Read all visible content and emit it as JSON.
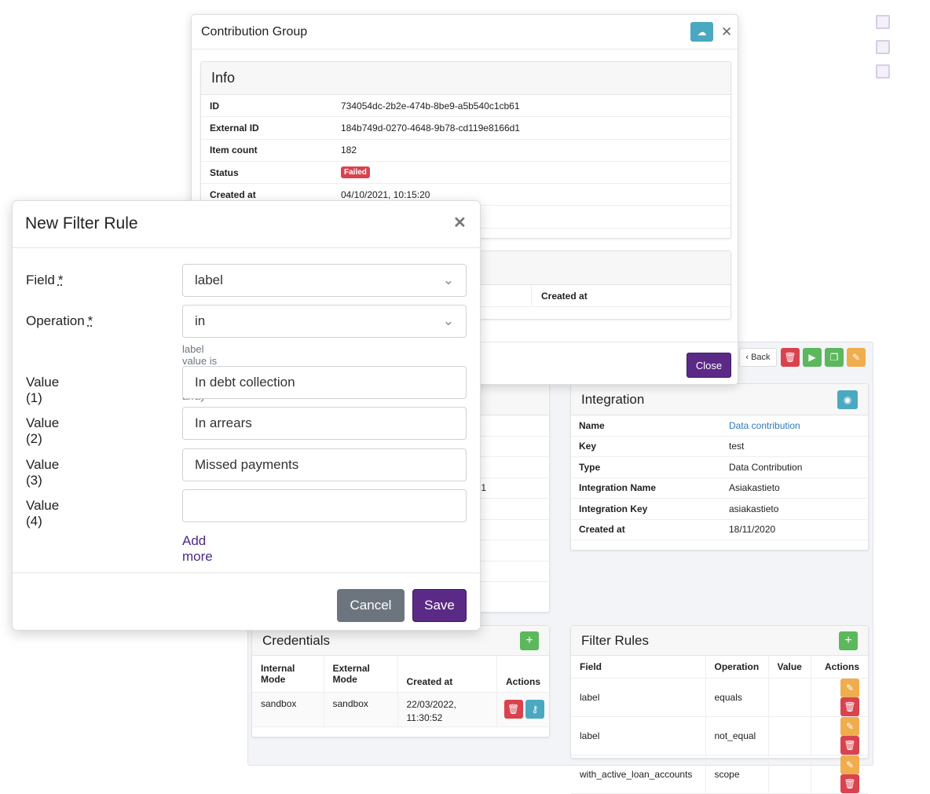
{
  "checkboxes": [
    false,
    false,
    false
  ],
  "toolbar": {
    "back_label": "Back",
    "buttons": [
      "trash-icon",
      "play-icon",
      "copy-icon",
      "edit-icon"
    ]
  },
  "left_card": {
    "visible_fragment": "1"
  },
  "integration": {
    "title": "Integration",
    "rows": [
      {
        "k": "Name",
        "v": "Data contribution",
        "link": true
      },
      {
        "k": "Key",
        "v": "test"
      },
      {
        "k": "Type",
        "v": "Data Contribution"
      },
      {
        "k": "Integration Name",
        "v": "Asiakastieto"
      },
      {
        "k": "Integration Key",
        "v": "asiakastieto"
      },
      {
        "k": "Created at",
        "v": "18/11/2020"
      }
    ]
  },
  "credentials": {
    "title": "Credentials",
    "headers": [
      "Internal Mode",
      "External Mode",
      "Created at",
      "Actions"
    ],
    "rows": [
      {
        "internal": "sandbox",
        "external": "sandbox",
        "created_at": "22/03/2022, 11:30:52"
      }
    ]
  },
  "filter_rules": {
    "title": "Filter Rules",
    "headers": [
      "Field",
      "Operation",
      "Value",
      "Actions"
    ],
    "rows": [
      {
        "field": "label",
        "operation": "equals",
        "value": ""
      },
      {
        "field": "label",
        "operation": "not_equal",
        "value": ""
      },
      {
        "field": "with_active_loan_accounts",
        "operation": "scope",
        "value": ""
      }
    ]
  },
  "contribution_modal": {
    "title": "Contribution Group",
    "info_title": "Info",
    "rows": [
      {
        "k": "ID",
        "v": "734054dc-2b2e-474b-8be9-a5b540c1cb61"
      },
      {
        "k": "External ID",
        "v": "184b749d-0270-4648-9b78-cd119e8166d1"
      },
      {
        "k": "Item count",
        "v": "182"
      },
      {
        "k": "Status",
        "v": "Failed",
        "badge": true
      },
      {
        "k": "Created at",
        "v": "04/10/2021, 10:15:20"
      }
    ],
    "second_table_header": "Created at",
    "close_label": "Close",
    "status_color": "#d9434e"
  },
  "filter_modal": {
    "title": "New Filter Rule",
    "field_label": "Field",
    "field_value": "label",
    "operation_label": "Operation",
    "operation_value": "in",
    "required_mark": "*",
    "help": "label value is in <value[]> array",
    "values": [
      {
        "label": "Value (1)",
        "value": "In debt collection"
      },
      {
        "label": "Value (2)",
        "value": "In arrears"
      },
      {
        "label": "Value (3)",
        "value": "Missed payments"
      },
      {
        "label": "Value (4)",
        "value": ""
      }
    ],
    "add_more": "Add more",
    "cancel": "Cancel",
    "save": "Save"
  },
  "colors": {
    "primary": "#5b2a86",
    "danger": "#d9434e",
    "success": "#5cb85c",
    "info": "#4aa8c0",
    "warning": "#f0ad4e",
    "link": "#2f7ab8"
  }
}
